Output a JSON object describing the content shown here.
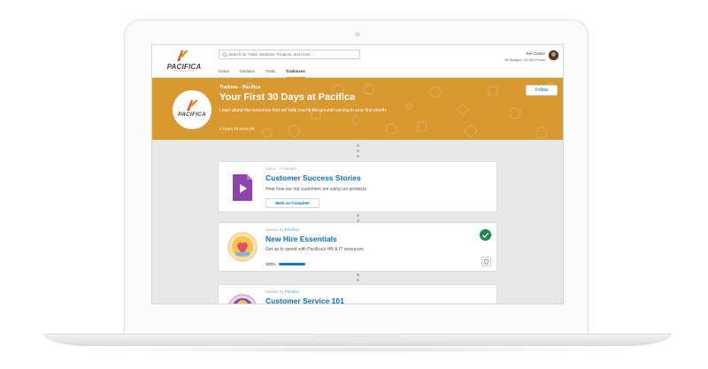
{
  "header": {
    "logo_text": "PACIFICA",
    "logo_sub": "APPAREL & CO",
    "search_placeholder": "Search for Trails, Modules, Projects, and more...",
    "nav_tabs": [
      {
        "label": "Home",
        "active": false
      },
      {
        "label": "Modules",
        "active": false
      },
      {
        "label": "Trails",
        "active": false
      },
      {
        "label": "Trailmixes",
        "active": true
      }
    ],
    "user_name": "Kel Cortez",
    "user_stats": "56 Badges, 23,450 Points"
  },
  "banner": {
    "eyebrow": "Trailmix - Pacifica",
    "title": "Your First 30 Days at Pacifica",
    "description": "Learn about the resources that will help you hit the ground running in your first month.",
    "time_left": "4 hours 20 mins left",
    "follow_label": "Follow",
    "logo_text": "PACIFICA"
  },
  "cards": [
    {
      "meta": "Video - 2 minutes",
      "title": "Customer Success Stories",
      "description": "Hear how our top customers are using our products.",
      "button_label": "Mark as Complete",
      "icon": "video-play-icon"
    },
    {
      "meta_prefix": "Module by ",
      "meta_link": "Pacifica",
      "title": "New Hire Essentials",
      "description": "Get up to speed with Pacifica's HR & IT resources.",
      "progress_label": "100%",
      "progress": 1.0,
      "completed": true,
      "icon": "heart-badge-icon"
    },
    {
      "meta_prefix": "Module by ",
      "meta_link": "Pacifica",
      "title": "Customer Service 101",
      "icon": "service-badge-icon"
    }
  ],
  "colors": {
    "banner": "#d99931",
    "link": "#0a6ebd",
    "accent": "#e89730",
    "success": "#1f8a4c",
    "progress": "#1877d0",
    "video_icon": "#8e44ad"
  }
}
